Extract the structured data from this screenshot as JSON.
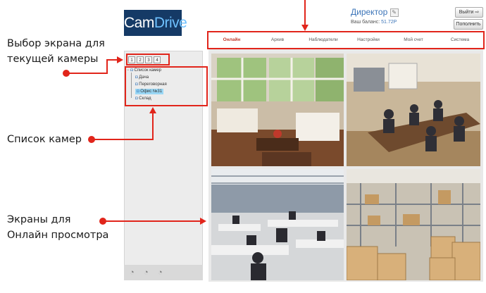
{
  "app": {
    "logo_text": "CamDrive",
    "logo_main": "Cam",
    "logo_accent": "Drive"
  },
  "header": {
    "user": "Директор",
    "balance_label": "Ваш баланс:",
    "balance_value": "51.72Р",
    "logout": "Выйти",
    "topup": "Пополнить"
  },
  "tabs": [
    "Онлайн",
    "Архив",
    "Наблюдатели",
    "Настройки",
    "Мой счет",
    "Система"
  ],
  "active_tab": "Онлайн",
  "screen_selector": [
    "1",
    "2",
    "3",
    "4"
  ],
  "camera_tree": {
    "root": "Список камер",
    "items": [
      "Дача",
      "Переговорная",
      "Офис №31",
      "Склад"
    ],
    "selected": "Офис №31"
  },
  "annotations": {
    "screen_select": [
      "Выбор экрана для",
      "текущей камеры"
    ],
    "camera_list": "Список камер",
    "screens": [
      "Экраны для",
      "Онлайн просмотра"
    ]
  },
  "colors": {
    "accent_red": "#e1251b",
    "logo_bg": "#153a66",
    "link_blue": "#3b74b8",
    "selected_bg": "#9ad7f5"
  },
  "icons": {
    "edit": "pencil-icon",
    "logout": "exit-icon",
    "camera": "camera-icon",
    "toolbar": "camera-control-icon"
  }
}
